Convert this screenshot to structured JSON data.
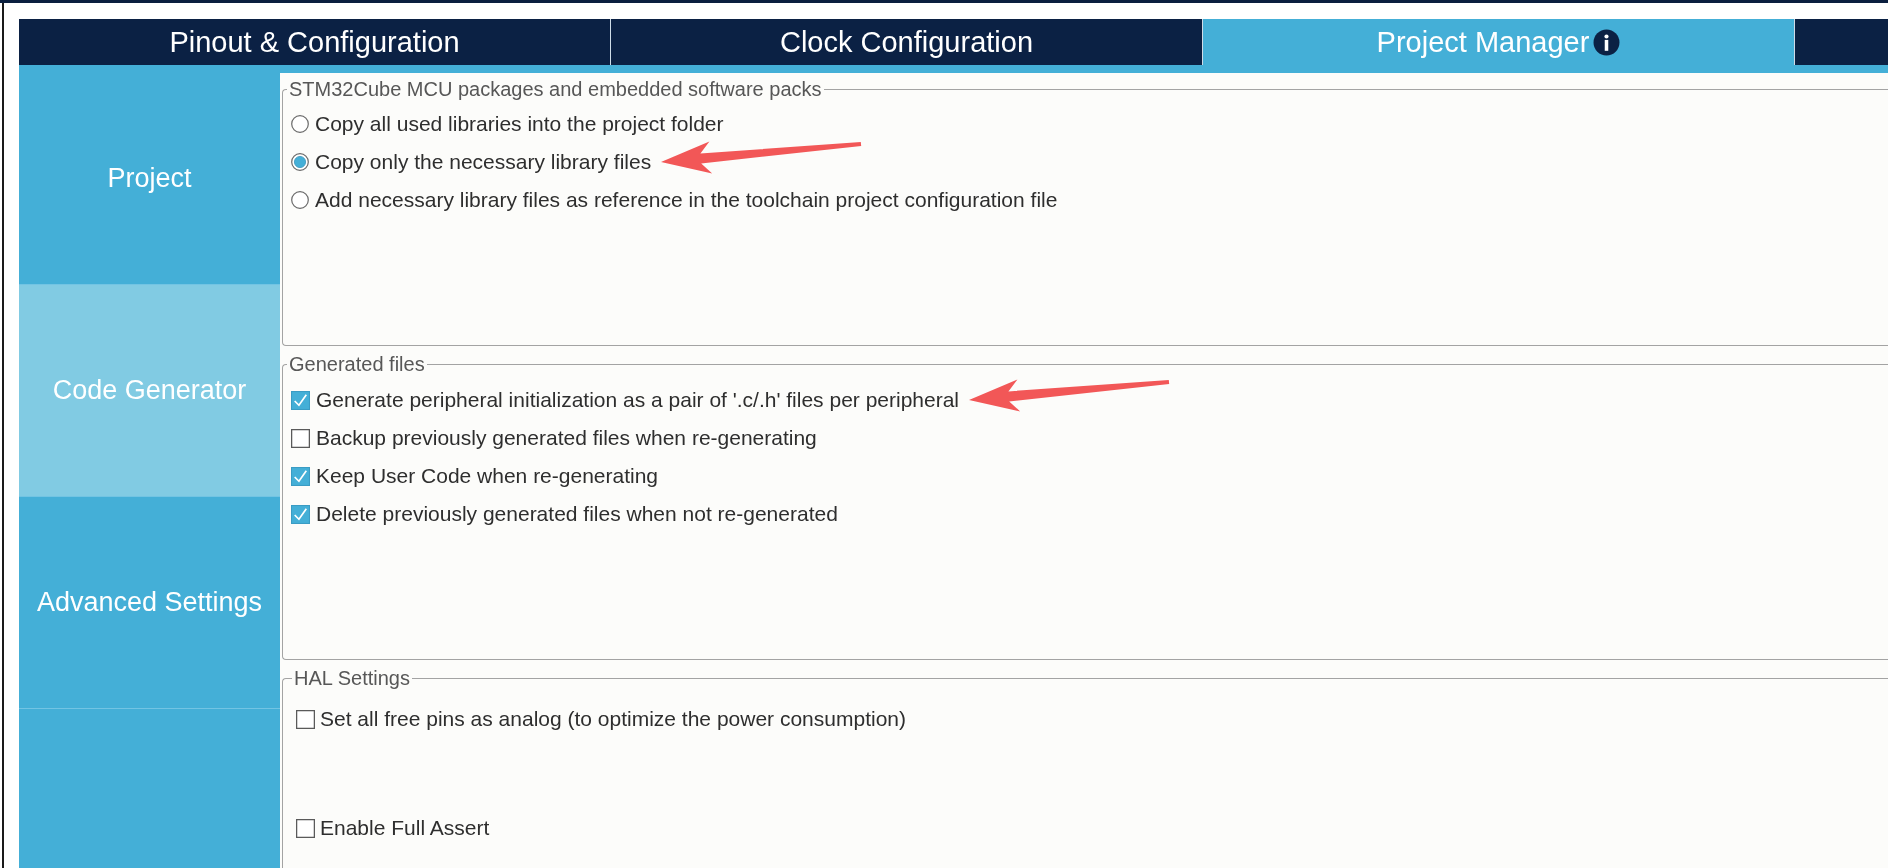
{
  "tabs": [
    {
      "label": "Pinout & Configuration",
      "selected": false,
      "info": false
    },
    {
      "label": "Clock Configuration",
      "selected": false,
      "info": false
    },
    {
      "label": "Project Manager",
      "selected": true,
      "info": true
    }
  ],
  "sidebar": {
    "items": [
      {
        "label": "Project",
        "selected": false
      },
      {
        "label": "Code Generator",
        "selected": true
      },
      {
        "label": "Advanced Settings",
        "selected": false
      }
    ]
  },
  "groups": [
    {
      "title": "STM32Cube MCU packages and embedded software packs",
      "options": [
        {
          "kind": "radio",
          "label": "Copy all used libraries into the project folder",
          "selected": false,
          "annotated": false
        },
        {
          "kind": "radio",
          "label": "Copy only the necessary library files",
          "selected": true,
          "annotated": true
        },
        {
          "kind": "radio",
          "label": "Add necessary library files as reference in the toolchain project configuration file",
          "selected": false,
          "annotated": false
        }
      ]
    },
    {
      "title": "Generated files",
      "options": [
        {
          "kind": "checkbox",
          "label": "Generate peripheral initialization as a pair of '.c/.h' files per peripheral",
          "checked": true,
          "annotated": true
        },
        {
          "kind": "checkbox",
          "label": "Backup previously generated files when re-generating",
          "checked": false,
          "annotated": false
        },
        {
          "kind": "checkbox",
          "label": "Keep User Code when re-generating",
          "checked": true,
          "annotated": false
        },
        {
          "kind": "checkbox",
          "label": "Delete previously generated files when not re-generated",
          "checked": true,
          "annotated": false
        }
      ]
    },
    {
      "title": "HAL Settings",
      "options": [
        {
          "kind": "checkbox",
          "label": "Set all free pins as analog (to optimize the power consumption)",
          "checked": false,
          "annotated": false
        },
        {
          "kind": "checkbox",
          "label": "Enable Full Assert",
          "checked": false,
          "annotated": false
        }
      ]
    }
  ]
}
